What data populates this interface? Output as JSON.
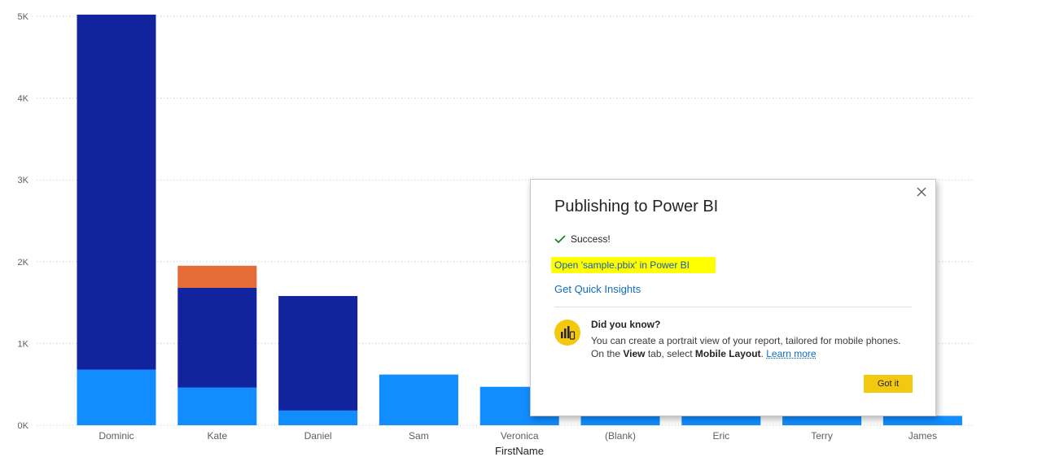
{
  "chart_data": {
    "type": "bar",
    "stacked": true,
    "categories": [
      "Dominic",
      "Kate",
      "Daniel",
      "Sam",
      "Veronica",
      "(Blank)",
      "Eric",
      "Terry",
      "James"
    ],
    "series": [
      {
        "color": "#118dff",
        "values": [
          680,
          460,
          180,
          620,
          470,
          110,
          110,
          110,
          115
        ]
      },
      {
        "color": "#12239e",
        "values": [
          4340,
          1220,
          1400,
          0,
          0,
          0,
          0,
          0,
          0
        ]
      },
      {
        "color": "#e66c37",
        "values": [
          0,
          270,
          0,
          0,
          0,
          0,
          0,
          0,
          0
        ]
      }
    ],
    "xlabel": "FirstName",
    "ylabel": "",
    "ylim": [
      0,
      5000
    ],
    "yticks": [
      0,
      1000,
      2000,
      3000,
      4000,
      5000
    ],
    "ytick_labels": [
      "0K",
      "1K",
      "2K",
      "3K",
      "4K",
      "5K"
    ],
    "grid": true
  },
  "dialog": {
    "title": "Publishing to Power BI",
    "status": "Success!",
    "open_link": "Open 'sample.pbix' in Power BI",
    "insights_link": "Get Quick Insights",
    "tip_title": "Did you know?",
    "tip_line1": "You can create a portrait view of your report, tailored for mobile phones.",
    "tip_line2_a": "On the ",
    "tip_line2_view": "View",
    "tip_line2_b": " tab, select ",
    "tip_line2_mobile": "Mobile Layout",
    "tip_line2_c": ". ",
    "learn_more": "Learn more",
    "got_it": "Got it",
    "colors": {
      "accent": "#f2c811",
      "highlight": "#ffff00",
      "link": "#0f6cbd"
    }
  }
}
